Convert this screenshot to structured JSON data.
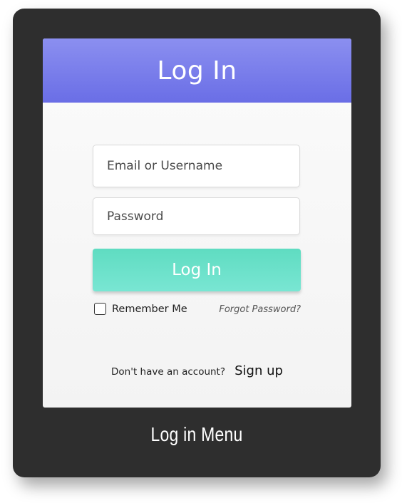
{
  "header": {
    "title": "Log In"
  },
  "form": {
    "email_placeholder": "Email or Username",
    "password_placeholder": "Password",
    "submit_label": "Log In",
    "remember_label": "Remember Me",
    "remember_checked": false,
    "forgot_label": "Forgot Password?"
  },
  "footer": {
    "prompt": "Don't have an account?",
    "signup_label": "Sign up"
  },
  "caption": "Log in Menu",
  "colors": {
    "header": "#7a7eec",
    "button": "#6be2cb",
    "frame": "#2e2e2e"
  }
}
